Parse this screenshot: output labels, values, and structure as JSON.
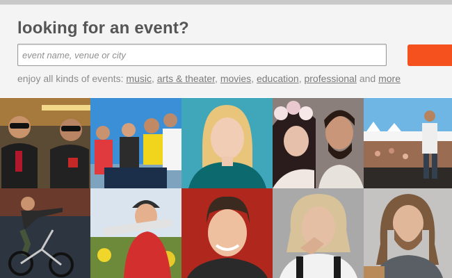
{
  "search": {
    "headline": "looking for an event?",
    "placeholder": "event name, venue or city"
  },
  "categories": {
    "intro": "enjoy all kinds of events: ",
    "links": [
      "music",
      "arts & theater",
      "movies",
      "education",
      "professional"
    ],
    "and_text": " and ",
    "more": "more"
  },
  "colors": {
    "accent": "#f4511e",
    "heading": "#555555",
    "panel_bg": "#f4f4f4"
  },
  "photo_grid": {
    "rows": 2,
    "columns": 5,
    "tiles": [
      "duo-in-sunglasses-photo",
      "group-on-steps-photo",
      "blonde-woman-portrait-photo",
      "couple-with-flower-crown-photo",
      "festival-guitarist-photo",
      "bmx-rider-photo",
      "guitarist-in-cap-photo",
      "man-on-red-background-photo",
      "woman-with-hand-on-chin-photo",
      "bearded-man-with-guitar-photo"
    ]
  }
}
